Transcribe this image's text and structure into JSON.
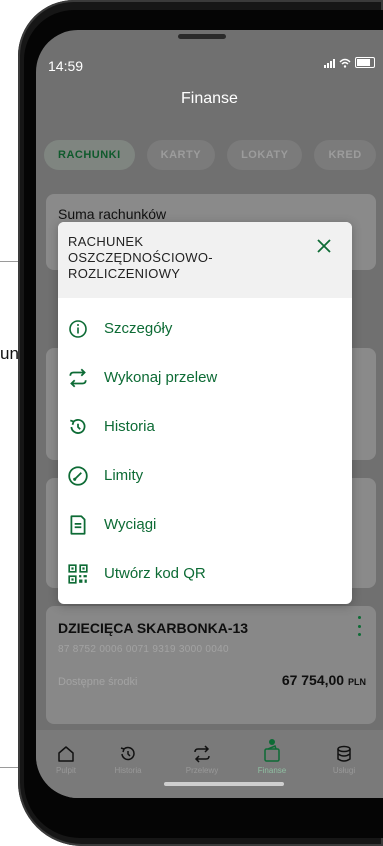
{
  "outside": {
    "partial_text": "unku"
  },
  "status": {
    "time": "14:59"
  },
  "header": {
    "title": "Finanse"
  },
  "tabs": [
    {
      "label": "RACHUNKI",
      "active": true
    },
    {
      "label": "KARTY",
      "active": false
    },
    {
      "label": "LOKATY",
      "active": false
    },
    {
      "label": "KRED",
      "active": false
    }
  ],
  "summary": {
    "label": "Suma rachunków"
  },
  "modal": {
    "title": "RACHUNEK OSZCZĘDNOŚCIOWO-ROZLICZENIOWY",
    "items": [
      {
        "label": "Szczegóły",
        "icon": "info-icon"
      },
      {
        "label": "Wykonaj przelew",
        "icon": "transfer-icon"
      },
      {
        "label": "Historia",
        "icon": "history-icon"
      },
      {
        "label": "Limity",
        "icon": "limits-icon"
      },
      {
        "label": "Wyciągi",
        "icon": "statements-icon"
      },
      {
        "label": "Utwórz kod QR",
        "icon": "qr-code-icon"
      }
    ]
  },
  "account": {
    "name": "DZIECIĘCA SKARBONKA-13",
    "number": "87 8752 0006 0071 9319 3000 0040",
    "available_label": "Dostępne środki",
    "amount": "67 754,00",
    "currency": "PLN"
  },
  "nav": [
    {
      "label": "Pulpit",
      "icon": "home-icon",
      "active": false
    },
    {
      "label": "Historia",
      "icon": "history-icon",
      "active": false
    },
    {
      "label": "Przelewy",
      "icon": "transfer-icon",
      "active": false
    },
    {
      "label": "Finanse",
      "icon": "wallet-icon",
      "active": true
    },
    {
      "label": "Usługi",
      "icon": "database-icon",
      "active": false
    }
  ],
  "colors": {
    "brand_green": "#0d6b35",
    "overlay_gray": "#707070"
  }
}
